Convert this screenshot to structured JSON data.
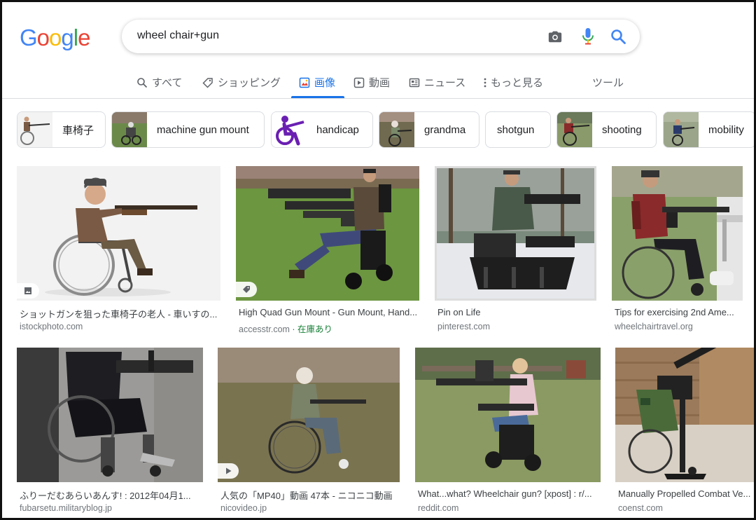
{
  "logo": [
    "G",
    "o",
    "o",
    "g",
    "l",
    "e"
  ],
  "search": {
    "query": "wheel chair+gun"
  },
  "tabs": [
    {
      "label": "すべて"
    },
    {
      "label": "ショッピング"
    },
    {
      "label": "画像"
    },
    {
      "label": "動画"
    },
    {
      "label": "ニュース"
    },
    {
      "label": "もっと見る"
    },
    {
      "label": "ツール"
    }
  ],
  "chips": [
    {
      "label": "車椅子"
    },
    {
      "label": "machine gun mount"
    },
    {
      "label": "handicap"
    },
    {
      "label": "grandma"
    },
    {
      "label": "shotgun"
    },
    {
      "label": "shooting"
    },
    {
      "label": "mobility"
    }
  ],
  "results": [
    {
      "title": "ショットガンを狙った車椅子の老人 - 車いすの...",
      "source": "istockphoto.com",
      "badge": "image-icon"
    },
    {
      "title": "High Quad Gun Mount - Gun Mount, Hand...",
      "source": "accesstr.com",
      "stock": "· 在庫あり",
      "badge": "tag-icon"
    },
    {
      "title": "Pin on Life",
      "source": "pinterest.com"
    },
    {
      "title": "Tips for exercising 2nd Ame...",
      "source": "wheelchairtravel.org"
    },
    {
      "title": "ふりーだむあらいあんす! : 2012年04月1...",
      "source": "fubarsetu.militaryblog.jp"
    },
    {
      "title": "人気の「MP40」動画 47本 - ニコニコ動画",
      "source": "nicovideo.jp",
      "badge": "play-icon"
    },
    {
      "title": "What...what? Wheelchair gun? [xpost] : r/...",
      "source": "reddit.com"
    },
    {
      "title": "Manually Propelled Combat Ve...",
      "source": "coenst.com"
    }
  ],
  "colors": {
    "accent": "#1a73e8",
    "logo": [
      "#4285f4",
      "#ea4335",
      "#fbbc05",
      "#4285f4",
      "#34a853",
      "#ea4335"
    ],
    "stock_green": "#188038"
  }
}
